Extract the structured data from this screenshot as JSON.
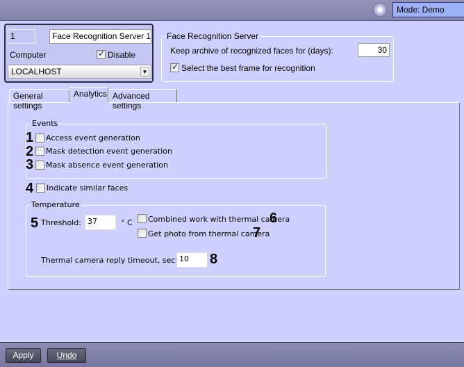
{
  "topbar": {
    "mode": "Mode: Demo",
    "icon": "gear-icon"
  },
  "server": {
    "id": "1",
    "name": "Face Recognition Server 1",
    "computer_label": "Computer",
    "disable_label": "Disable",
    "disable_checked": true,
    "computer_value": "LOCALHOST"
  },
  "frs_group": {
    "title": "Face Recognition Server",
    "archive_label": "Keep archive of recognized faces for (days):",
    "archive_value": "30",
    "best_frame_label": "Select the best frame for recognition",
    "best_frame_checked": true
  },
  "tabs": [
    {
      "label": "General settings"
    },
    {
      "label": "Analytics",
      "active": true
    },
    {
      "label": "Advanced settings"
    }
  ],
  "events": {
    "title": "Events",
    "items": [
      {
        "marker": "1",
        "label": "Access event generation"
      },
      {
        "marker": "2",
        "label": "Mask detection event generation"
      },
      {
        "marker": "3",
        "label": "Mask absence event generation"
      }
    ]
  },
  "similar": {
    "marker": "4",
    "label": "Indicate similar faces"
  },
  "temperature": {
    "title": "Temperature",
    "threshold_marker": "5",
    "threshold_label": "Threshold:",
    "threshold_value": "37",
    "unit": "° C",
    "combined_label": "Combined work with thermal camera",
    "combined_marker": "6",
    "photo_label": "Get photo from thermal camera",
    "photo_marker": "7",
    "timeout_label": "Thermal camera reply timeout, sec:",
    "timeout_value": "10",
    "timeout_marker": "8"
  },
  "buttons": {
    "apply": "Apply",
    "undo": "Undo"
  }
}
